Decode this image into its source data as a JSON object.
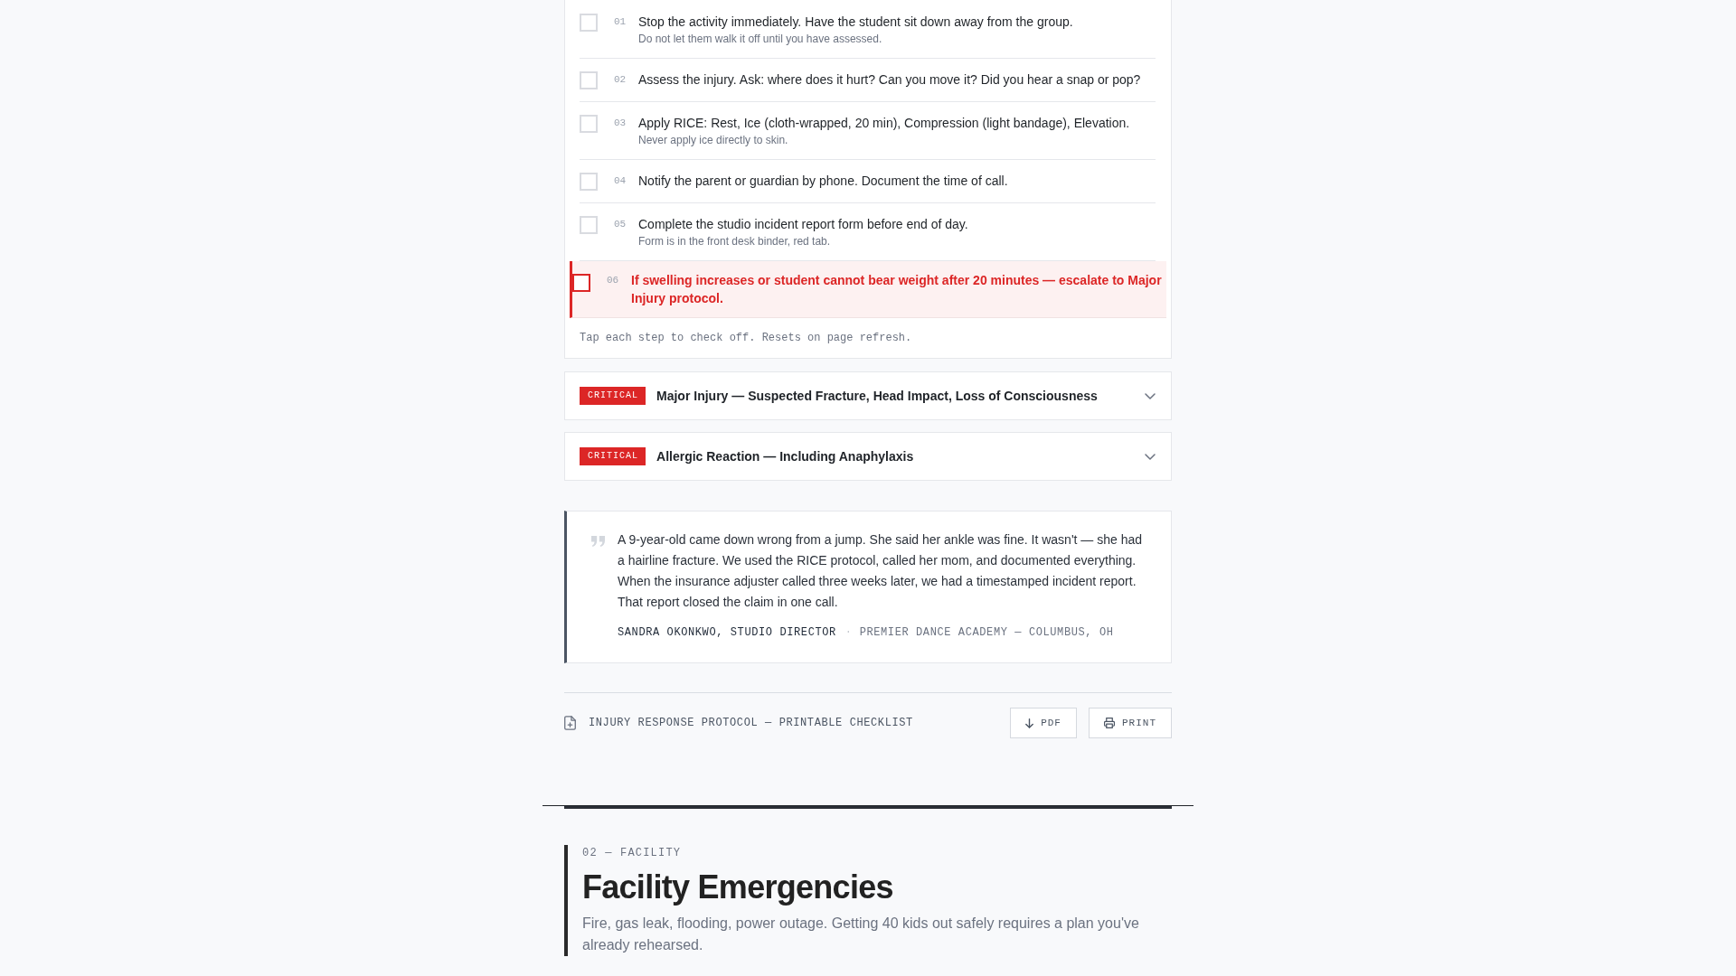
{
  "checklist": {
    "steps": [
      {
        "kind": "step",
        "number": "01",
        "text": "Stop the activity immediately. Have the student sit down away from the group.",
        "note": "Do not let them walk it off until you have assessed.",
        "checked": false
      },
      {
        "kind": "step",
        "number": "02",
        "text": "Assess the injury. Ask: where does it hurt? Can you move it? Did you hear a snap or pop?",
        "checked": false
      },
      {
        "kind": "step",
        "number": "03",
        "text": "Apply RICE: Rest, Ice (cloth-wrapped, 20 min), Compression (light bandage), Elevation.",
        "note": "Never apply ice directly to skin.",
        "checked": false
      },
      {
        "kind": "step",
        "number": "04",
        "text": "Notify the parent or guardian by phone. Document the time of call.",
        "checked": false
      },
      {
        "kind": "step",
        "number": "05",
        "text": "Complete the studio incident report form before end of day.",
        "note": "Form is in the front desk binder, red tab.",
        "checked": false
      },
      {
        "kind": "alert",
        "number": "06",
        "text": "If swelling increases or student cannot bear weight after 20 minutes — escalate to Major Injury protocol.",
        "checked": false
      }
    ],
    "footnote": "Tap each step to check off. Resets on page refresh."
  },
  "protocols": [
    {
      "badge": "CRITICAL",
      "title": "Major Injury — Suspected Fracture, Head Impact, Loss of Consciousness",
      "expanded": false
    },
    {
      "badge": "CRITICAL",
      "title": "Allergic Reaction — Including Anaphylaxis",
      "expanded": false
    }
  ],
  "testimonial": {
    "quote": "A 9-year-old came down wrong from a jump. She said her ankle was fine. It wasn't — she had a hairline fracture. We used the RICE protocol, called her mom, and documented everything. When the insurance adjuster called three weeks later, we had a timestamped incident report. That report closed the claim in one call.",
    "author": "SANDRA OKONKWO, STUDIO DIRECTOR",
    "separator": "·",
    "organization": "PREMIER DANCE ACADEMY — COLUMBUS, OH"
  },
  "download_bar": {
    "label": "INJURY RESPONSE PROTOCOL — PRINTABLE CHECKLIST",
    "buttons": [
      {
        "kind": "download",
        "label": "PDF"
      },
      {
        "kind": "print",
        "label": "PRINT"
      }
    ]
  },
  "section": {
    "eyebrow": "02 — FACILITY",
    "title": "Facility Emergencies",
    "description": "Fire, gas leak, flooding, power outage. Getting 40 kids out safely requires a plan you've already rehearsed."
  }
}
